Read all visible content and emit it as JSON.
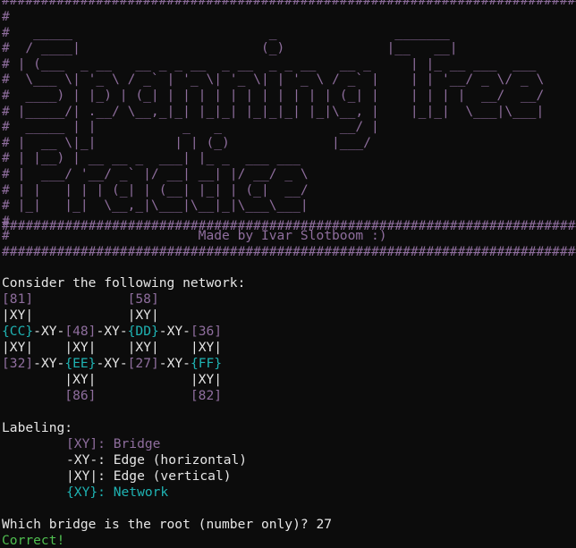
{
  "banner": {
    "border_line": "################################################################################",
    "art_lines": [
      "#                                                                              #",
      "#   _____                         _               _______                      #",
      "#  / ____|                       (_)             |__   __|                     #",
      "# | (___  _ __   __ _ _ __  _ __  _ _ __   __ _     | |_ __ ___  ___           #",
      "#  \\___ \\| '_ \\ / _` | '_ \\| '_ \\| | '_ \\ / _` |    | | '__/ _ \\/ _ \\          #",
      "#  ____) | |_) | (_| | | | | | | | | | | | (_| |    | | | |  __/  __/          #",
      "# |_____/| .__/ \\__,_|_| |_|_| |_|_|_| |_|\\__, |    |_|_|  \\___|\\___|          #",
      "#  _____ | |           _   _               __/ |                               #",
      "# |  __ \\|_|          | | (_)             |___/                                #",
      "# | |__) | __ __ _  ___| |_ _  ___ ___                                          #",
      "# |  ___/ '__/ _` |/ __| __| |/ __/ _ \\                                         #",
      "# | |   | | | (_| | (__| |_| | (_|  __/                                         #",
      "# |_|   |_|  \\__,_|\\___|\\__|_|\\___\\___|                                         #",
      "#                                                                              #"
    ],
    "credit_line": "#                        Made by Ivar Slotboom :)                              #"
  },
  "prompt_intro": "Consider the following network:",
  "network_lines": [
    [
      {
        "t": "[81]",
        "c": "bridge"
      },
      {
        "t": "            ",
        "c": ""
      },
      {
        "t": "[58]",
        "c": "bridge"
      }
    ],
    [
      {
        "t": "|XY|",
        "c": ""
      },
      {
        "t": "            ",
        "c": ""
      },
      {
        "t": "|XY|",
        "c": ""
      }
    ],
    [
      {
        "t": "{CC}",
        "c": "net"
      },
      {
        "t": "-XY-",
        "c": ""
      },
      {
        "t": "[48]",
        "c": "bridge"
      },
      {
        "t": "-XY-",
        "c": ""
      },
      {
        "t": "{DD}",
        "c": "net"
      },
      {
        "t": "-XY-",
        "c": ""
      },
      {
        "t": "[36]",
        "c": "bridge"
      }
    ],
    [
      {
        "t": "|XY|",
        "c": ""
      },
      {
        "t": "    ",
        "c": ""
      },
      {
        "t": "|XY|",
        "c": ""
      },
      {
        "t": "    ",
        "c": ""
      },
      {
        "t": "|XY|",
        "c": ""
      },
      {
        "t": "    ",
        "c": ""
      },
      {
        "t": "|XY|",
        "c": ""
      }
    ],
    [
      {
        "t": "[32]",
        "c": "bridge"
      },
      {
        "t": "-XY-",
        "c": ""
      },
      {
        "t": "{EE}",
        "c": "net"
      },
      {
        "t": "-XY-",
        "c": ""
      },
      {
        "t": "[27]",
        "c": "bridge"
      },
      {
        "t": "-XY-",
        "c": ""
      },
      {
        "t": "{FF}",
        "c": "net"
      }
    ],
    [
      {
        "t": "        ",
        "c": ""
      },
      {
        "t": "|XY|",
        "c": ""
      },
      {
        "t": "            ",
        "c": ""
      },
      {
        "t": "|XY|",
        "c": ""
      }
    ],
    [
      {
        "t": "        ",
        "c": ""
      },
      {
        "t": "[86]",
        "c": "bridge"
      },
      {
        "t": "            ",
        "c": ""
      },
      {
        "t": "[82]",
        "c": "bridge"
      }
    ]
  ],
  "labeling": {
    "title": "Labeling:",
    "rows": [
      {
        "sym": "[XY]: ",
        "desc": "Bridge",
        "c": "bridge"
      },
      {
        "sym": "-XY-: ",
        "desc": "Edge (horizontal)",
        "c": ""
      },
      {
        "sym": "|XY|: ",
        "desc": "Edge (vertical)",
        "c": ""
      },
      {
        "sym": "{XY}: ",
        "desc": "Network",
        "c": "net"
      }
    ]
  },
  "question": "Which bridge is the root (number only)? ",
  "answer": "27",
  "result": "Correct!",
  "colors": {
    "background": "#0c0c0c",
    "text": "#e6e6e6",
    "bridge": "#8f6e9e",
    "network": "#1fb3b3",
    "success": "#4fbe4f"
  }
}
